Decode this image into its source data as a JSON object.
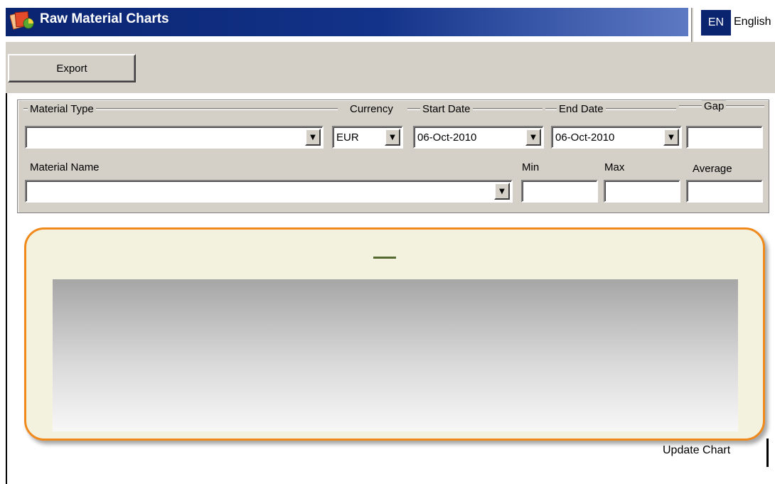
{
  "window": {
    "title": "Raw Material Charts",
    "icon": "app-charts-icon"
  },
  "language": {
    "code": "EN",
    "name": "English"
  },
  "toolbar": {
    "export_label": "Export"
  },
  "form": {
    "material_type": {
      "label": "Material Type",
      "value": ""
    },
    "currency": {
      "label": "Currency",
      "value": "EUR"
    },
    "start_date": {
      "label": "Start Date",
      "value": "06-Oct-2010"
    },
    "end_date": {
      "label": "End Date",
      "value": "06-Oct-2010"
    },
    "gap": {
      "label": "Gap",
      "value": ""
    },
    "material_name": {
      "label": "Material Name",
      "value": ""
    },
    "min": {
      "label": "Min",
      "value": ""
    },
    "max": {
      "label": "Max",
      "value": ""
    },
    "average": {
      "label": "Average",
      "value": ""
    }
  },
  "chart": {
    "legend_color": "#556b2f",
    "border_color": "#f08a1c"
  },
  "actions": {
    "update_chart_label": "Update Chart"
  }
}
